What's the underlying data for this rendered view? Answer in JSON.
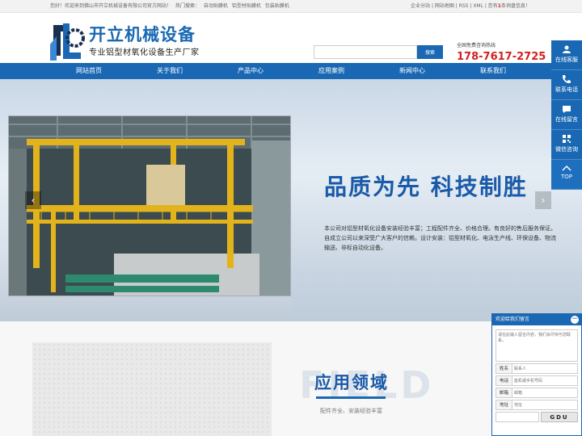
{
  "topbar": {
    "welcome": "您好！欢迎来到佛山市开立机械设备有限公司官方网站！",
    "hot_label": "热门搜索：",
    "hot_items": [
      "自动贴膜机",
      "铝型材贴膜机",
      "包装贴膜机"
    ],
    "right_text_before": "企业分站 | 网站地图 | RSS | XML | 您有",
    "right_count": "1",
    "right_text_after": "条询盘信息！"
  },
  "header": {
    "logo_title": "开立机械设备",
    "logo_slogan": "专业铝型材氧化设备生产厂家",
    "search_placeholder": "",
    "search_button": "搜索",
    "hotline_label": "全国免费咨询热线",
    "hotline_number": "178-7617-2725"
  },
  "nav": {
    "items": [
      "网站首页",
      "关于我们",
      "产品中心",
      "应用案例",
      "新闻中心",
      "联系我们"
    ]
  },
  "banner": {
    "headline": "品质为先 科技制胜",
    "description": "本公司对铝型材氧化设备安装经验丰富；工程配件齐全、价格合理。有良好的售后服务保证。自成立公司以来深受广大客户的信赖。设计安装：铝型材氧化、电泳生产线、环保设备、物流输送、非标自动化设备。",
    "prev_icon": "chevron-left-icon",
    "next_icon": "chevron-right-icon"
  },
  "section": {
    "bg_word": "FIELD",
    "title": "应用领域",
    "subtitle": "配件齐全、安装经验丰富"
  },
  "sidebar": {
    "items": [
      {
        "label": "在线客服",
        "icon": "user-icon"
      },
      {
        "label": "联系电话",
        "icon": "phone-icon"
      },
      {
        "label": "在线留言",
        "icon": "chat-icon"
      },
      {
        "label": "微信咨询",
        "icon": "qrcode-icon"
      },
      {
        "label": "TOP",
        "icon": "chevron-up-icon"
      }
    ]
  },
  "message_box": {
    "title": "欢迎给我们留言",
    "content_placeholder": "请在此输入留言内容，我们会尽快与您联系。",
    "fields": [
      {
        "label": "姓名",
        "placeholder": "联系人"
      },
      {
        "label": "电话",
        "placeholder": "座机或手机号码"
      },
      {
        "label": "邮箱",
        "placeholder": "邮箱"
      },
      {
        "label": "地址",
        "placeholder": "地址"
      }
    ],
    "captcha": "GDU"
  },
  "colors": {
    "brand": "#1a68b3",
    "hotline": "#d52020"
  }
}
